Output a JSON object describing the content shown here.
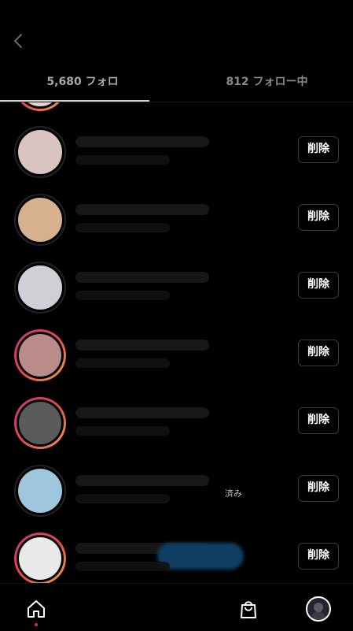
{
  "tabs": {
    "followers": "5,680 フォロ",
    "following": "812 フォロー中"
  },
  "rows": [
    {
      "remove_label": "削除",
      "ring": false,
      "avatar_color": "#d9c4c2",
      "sub_text": ""
    },
    {
      "remove_label": "削除",
      "ring": false,
      "avatar_color": "#d7b08e",
      "sub_text": ""
    },
    {
      "remove_label": "削除",
      "ring": false,
      "avatar_color": "#cfd0d6",
      "sub_text": ""
    },
    {
      "remove_label": "削除",
      "ring": true,
      "avatar_color": "#b98b8b",
      "sub_text": ""
    },
    {
      "remove_label": "削除",
      "ring": true,
      "avatar_color": "#5b5b5b",
      "sub_text": ""
    },
    {
      "remove_label": "削除",
      "ring": false,
      "avatar_color": "#9fc6dd",
      "sub_text": "済み"
    },
    {
      "remove_label": "削除",
      "ring": true,
      "avatar_color": "#e9e9ea",
      "sub_text": ""
    }
  ],
  "icons": {
    "back": "chevron-left-icon",
    "home": "home-icon",
    "shop": "shopping-bag-icon",
    "profile": "profile-avatar-icon"
  },
  "colors": {
    "background": "#000000",
    "accent_ring_start": "#c4348a",
    "accent_ring_end": "#f2a23a",
    "notification_dot": "#e3294d"
  }
}
